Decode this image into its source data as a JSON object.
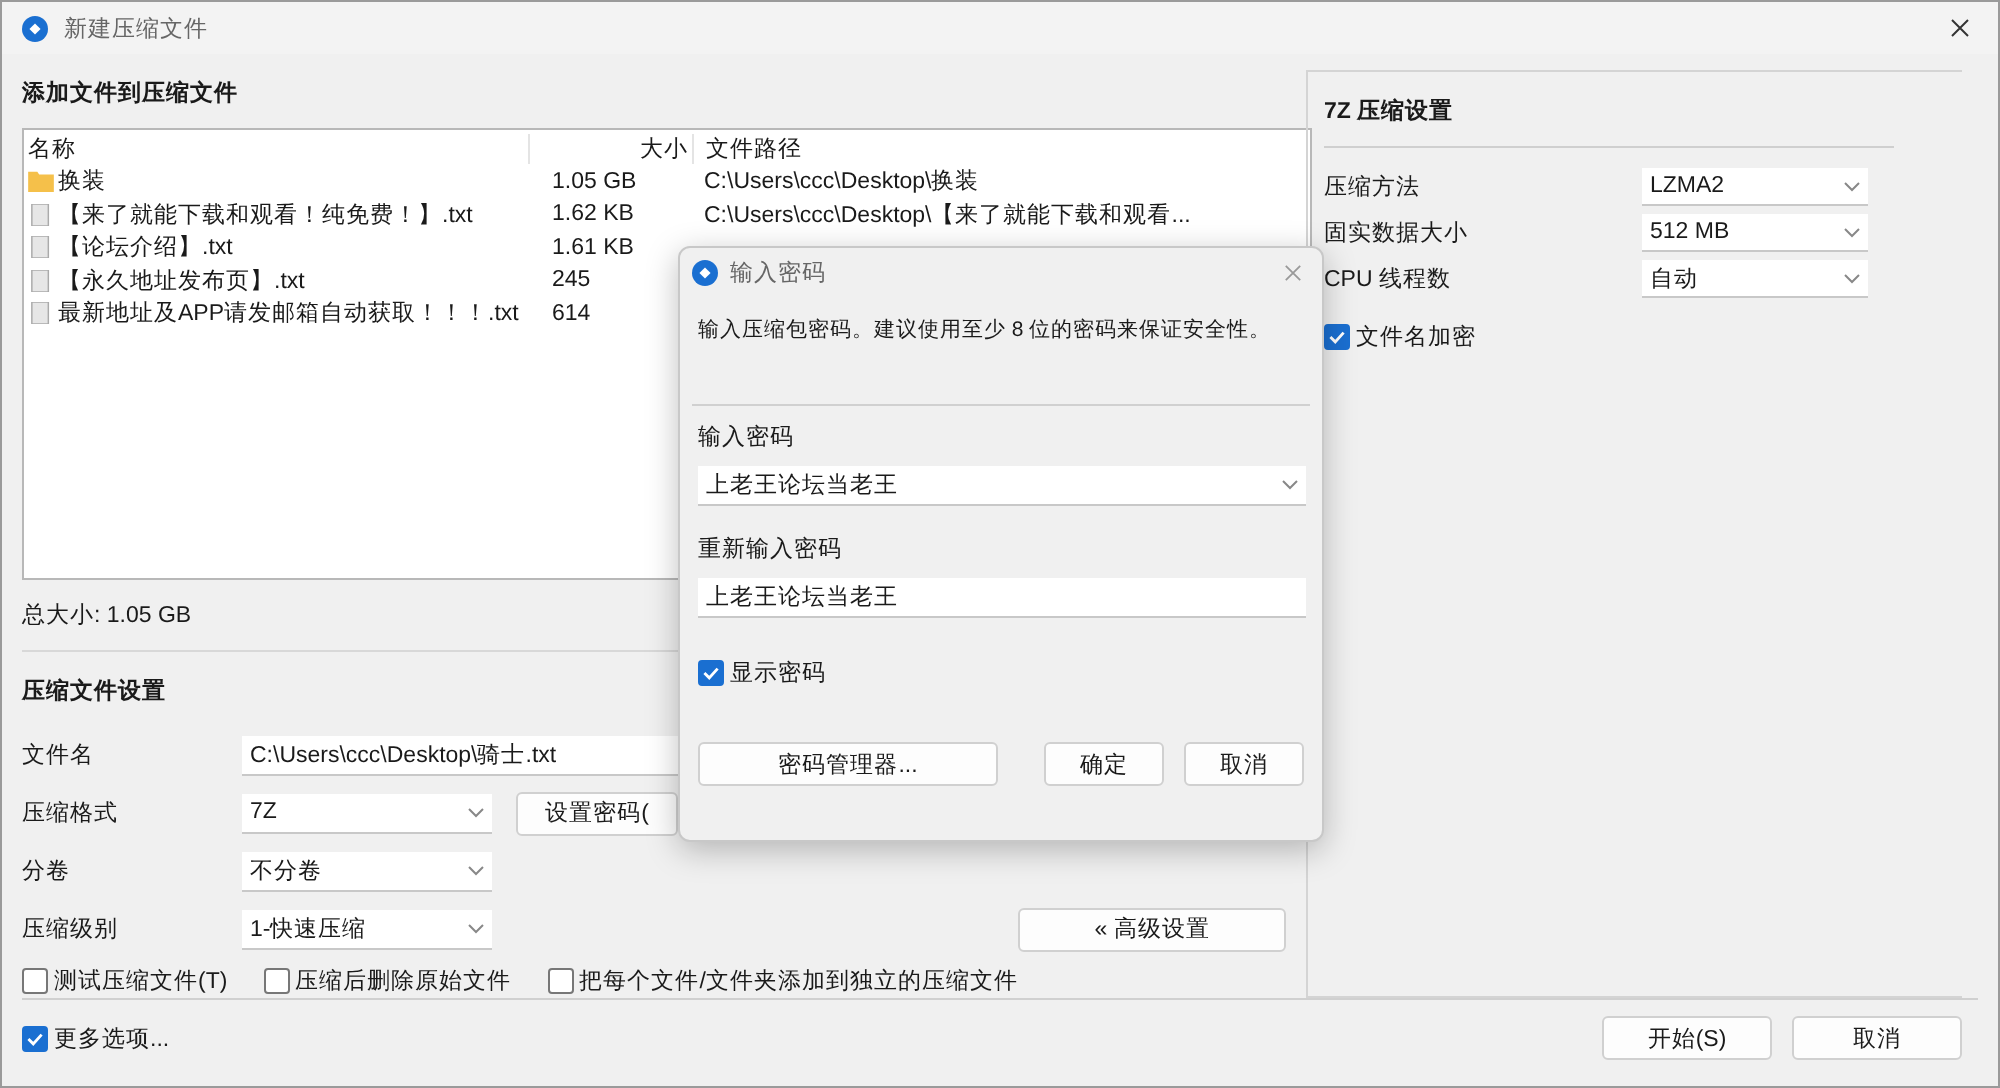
{
  "window": {
    "title": "新建压缩文件"
  },
  "files": {
    "heading": "添加文件到压缩文件",
    "columns": [
      "名称",
      "大小",
      "文件路径"
    ],
    "rows": [
      {
        "kind": "folder",
        "name": "换装",
        "size": "1.05 GB",
        "path": "C:\\Users\\ccc\\Desktop\\换装"
      },
      {
        "kind": "file",
        "name": "【来了就能下载和观看！纯免费！】.txt",
        "size": "1.62 KB",
        "path": "C:\\Users\\ccc\\Desktop\\【来了就能下载和观看..."
      },
      {
        "kind": "file",
        "name": "【论坛介绍】.txt",
        "size": "1.61 KB"
      },
      {
        "kind": "file",
        "name": "【永久地址发布页】.txt",
        "size": "245"
      },
      {
        "kind": "file",
        "name": "最新地址及APP请发邮箱自动获取！！！.txt",
        "size": "614"
      }
    ],
    "total": "总大小: 1.05 GB"
  },
  "archive_settings": {
    "heading": "压缩文件设置",
    "fields": [
      {
        "kind": "input",
        "label": "文件名",
        "value": "C:\\Users\\ccc\\Desktop\\骑士.txt"
      },
      {
        "kind": "select",
        "label": "压缩格式",
        "value": "7Z"
      },
      {
        "kind": "select",
        "label": "分卷",
        "value": "不分卷"
      },
      {
        "kind": "select",
        "label": "压缩级别",
        "value": "1-快速压缩"
      }
    ],
    "password_button": "设置密码(",
    "advanced_button": "« 高级设置",
    "options": [
      {
        "label": "测试压缩文件(T)",
        "checked": false
      },
      {
        "label": "压缩后删除原始文件",
        "checked": false
      },
      {
        "label": "把每个文件/文件夹添加到独立的压缩文件",
        "checked": false
      }
    ]
  },
  "format_settings": {
    "heading": "7Z 压缩设置",
    "fields": [
      {
        "label": "压缩方法",
        "value": "LZMA2"
      },
      {
        "label": "固实数据大小",
        "value": "512 MB"
      },
      {
        "label": "CPU 线程数",
        "value": "自动"
      }
    ],
    "options": [
      {
        "label": "文件名加密",
        "checked": true
      }
    ]
  },
  "more_options": {
    "label": "更多选项...",
    "checked": true
  },
  "buttons": [
    "开始(S)",
    "取消"
  ],
  "dialog": {
    "title": "输入密码",
    "message": "输入压缩包密码。建议使用至少 8 位的密码来保证安全性。",
    "password_label": "输入密码",
    "password": "上老王论坛当老王",
    "confirm_label": "重新输入密码",
    "confirm": "上老王论坛当老王",
    "show_password": {
      "label": "显示密码",
      "checked": true
    },
    "buttons": [
      "密码管理器...",
      "确定",
      "取消"
    ]
  }
}
